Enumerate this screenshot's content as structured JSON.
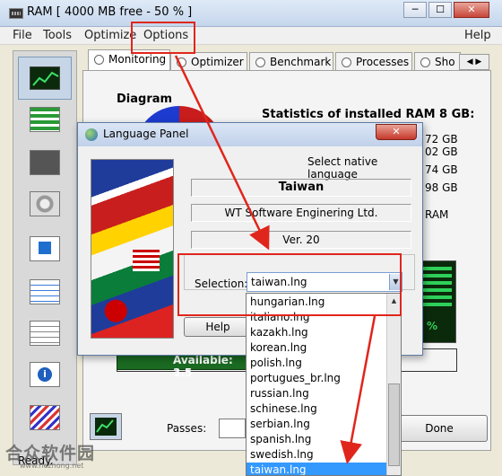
{
  "window": {
    "title": "RAM [ 4000 MB free - 50 % ]",
    "minimize": "─",
    "maximize": "☐",
    "close": "✕"
  },
  "menu": {
    "items": [
      "File",
      "Tools",
      "Optimize",
      "Options",
      "Help"
    ]
  },
  "tabs": [
    "Monitoring",
    "Optimizer",
    "Benchmark",
    "Processes",
    "Sho"
  ],
  "main": {
    "diagram_label": "Diagram",
    "stats_label": "Statistics of installed RAM 8 GB:",
    "stats_values": [
      "72 GB",
      "02 GB",
      "74 GB",
      "98 GB",
      "RAM"
    ],
    "available": "Available: 3.5",
    "percent": "%",
    "passes_label": "Passes:",
    "done_label": "Done",
    "status": "Ready."
  },
  "dialog": {
    "title": "Language Panel",
    "close": "✕",
    "prompt": "Select native language",
    "language": "Taiwan",
    "company": "WT Software Enginering Ltd.",
    "version": "Ver. 20",
    "selection_label": "Selection:",
    "selection_value": "taiwan.lng",
    "help_label": "Help"
  },
  "dropdown": {
    "options": [
      "hungarian.lng",
      "italiano.lng",
      "kazakh.lng",
      "korean.lng",
      "polish.lng",
      "portugues_br.lng",
      "russian.lng",
      "schinese.lng",
      "serbian.lng",
      "spanish.lng",
      "swedish.lng",
      "taiwan.lng"
    ],
    "selected": "taiwan.lng"
  },
  "watermark": {
    "logo": "合众软件园",
    "url": "www.hezhong.net"
  },
  "colors": {
    "annotation": "#e0261c",
    "selected": "#3399ff",
    "available_bar": "#1b6b22"
  }
}
